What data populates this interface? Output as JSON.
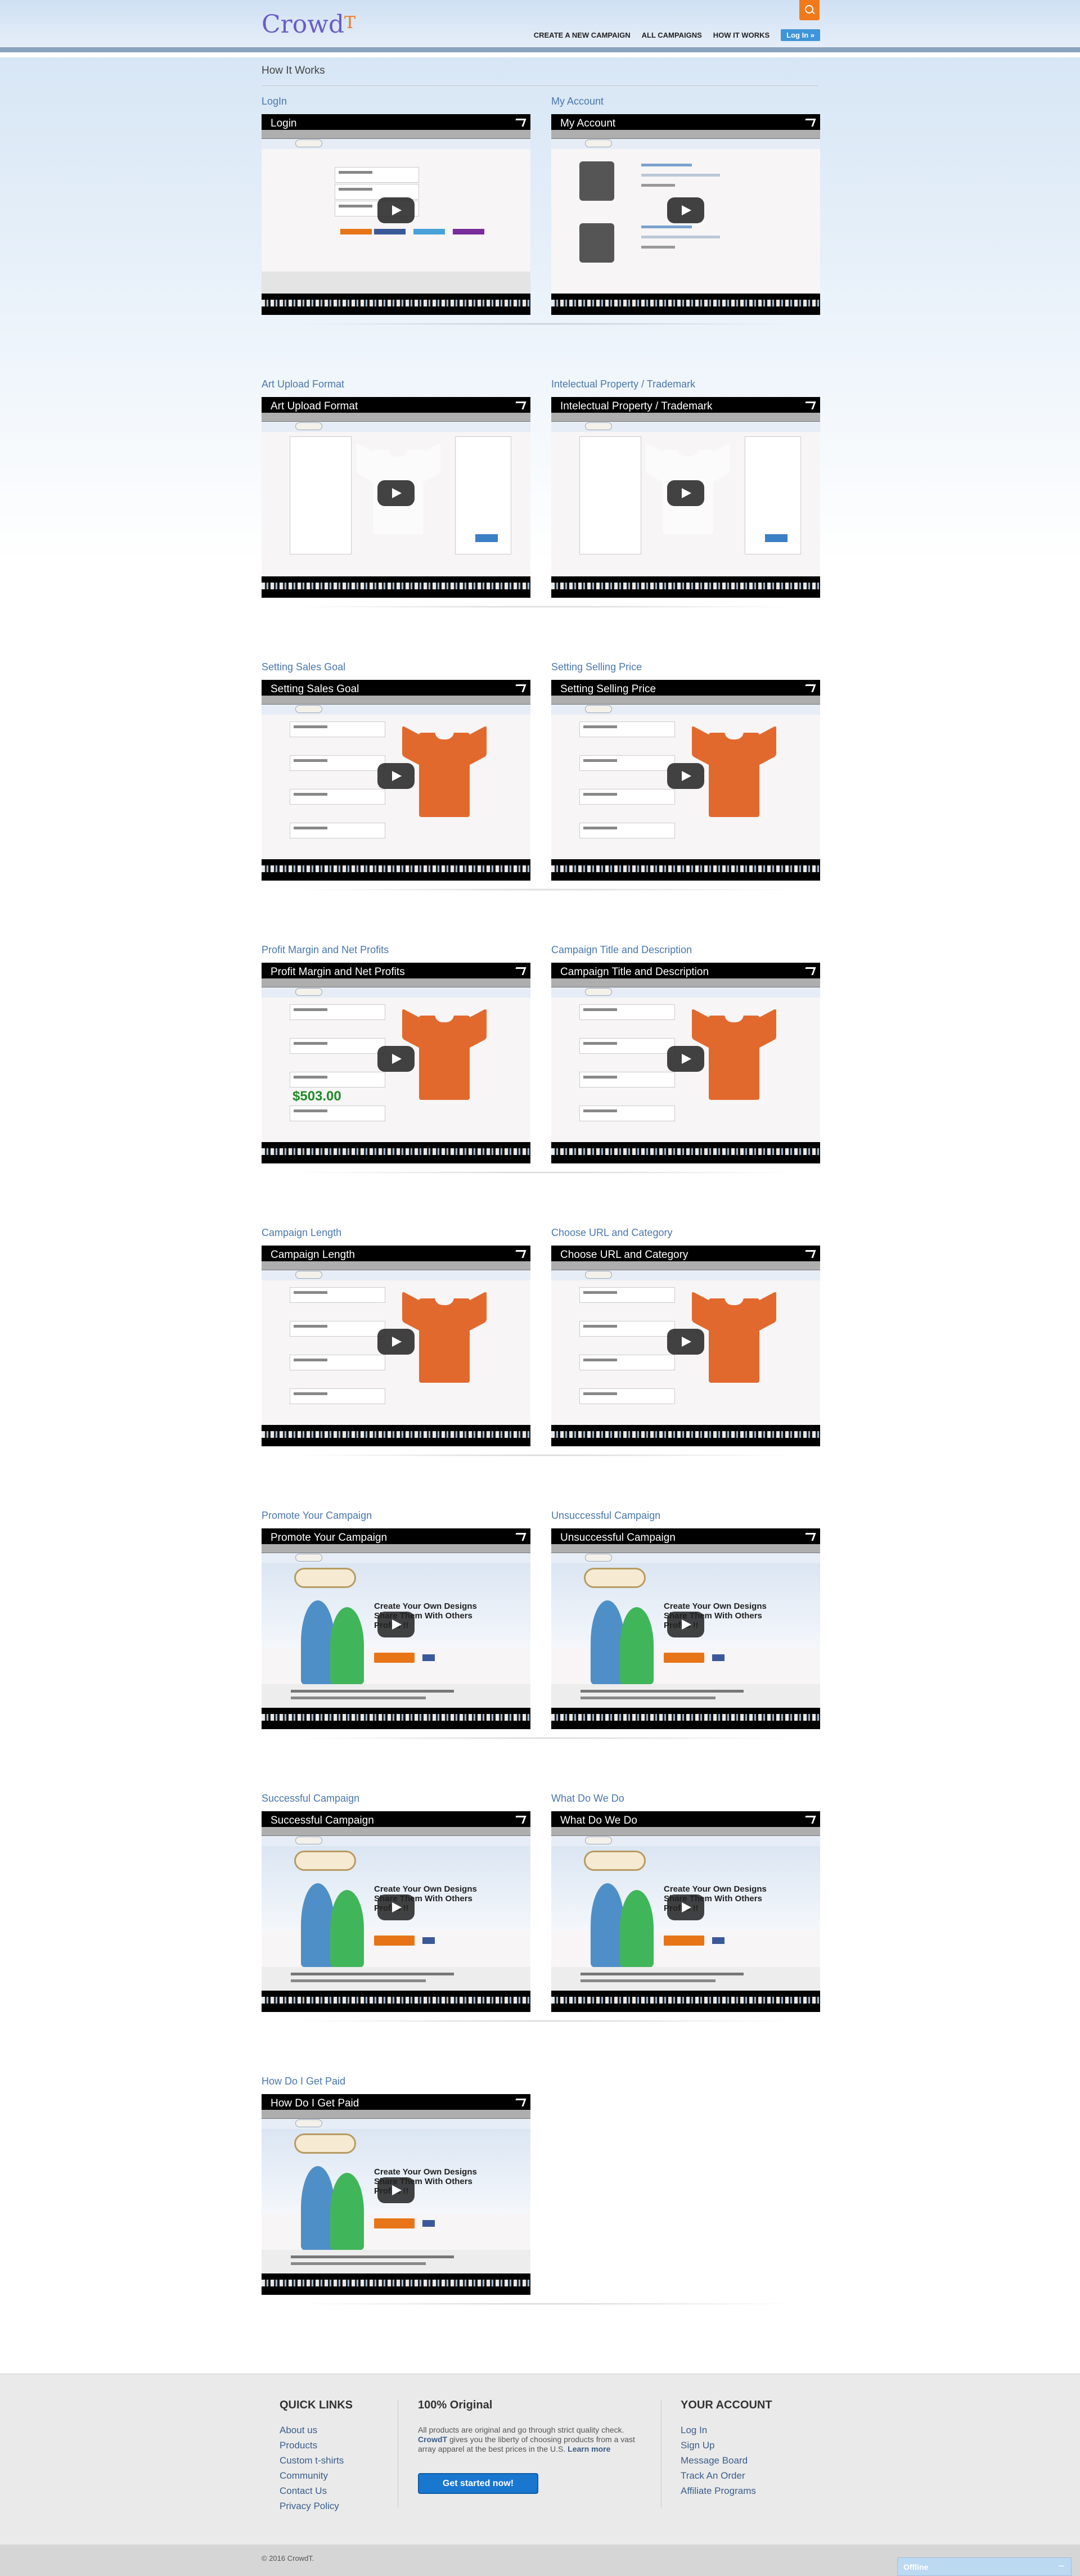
{
  "header": {
    "logo": "Crowd",
    "logo_suffix": "T",
    "nav": [
      "CREATE A NEW CAMPAIGN",
      "ALL CAMPAIGNS",
      "HOW IT WORKS"
    ],
    "login_label": "Log In »"
  },
  "page": {
    "title": "How It Works"
  },
  "videos": [
    {
      "title": "LogIn",
      "player_title": "Login",
      "screen": "login"
    },
    {
      "title": "My Account",
      "player_title": "My Account",
      "screen": "account"
    },
    {
      "title": "Art Upload Format",
      "player_title": "Art Upload Format",
      "screen": "white-shirt"
    },
    {
      "title": "Intelectual Property / Trademark",
      "player_title": "Intelectual Property / Trademark",
      "screen": "white-shirt"
    },
    {
      "title": "Setting Sales Goal",
      "player_title": "Setting Sales Goal",
      "screen": "orange-shirt"
    },
    {
      "title": "Setting Selling Price",
      "player_title": "Setting Selling Price",
      "screen": "orange-shirt"
    },
    {
      "title": "Profit Margin and Net Profits",
      "player_title": "Profit Margin and Net Profits",
      "screen": "orange-shirt-profit",
      "profit_value": "$503.00"
    },
    {
      "title": "Campaign Title and Description",
      "player_title": "Campaign Title and Description",
      "screen": "orange-shirt"
    },
    {
      "title": "Campaign Length",
      "player_title": "Campaign Length",
      "screen": "orange-shirt"
    },
    {
      "title": "Choose URL and Category",
      "player_title": "Choose URL and Category",
      "screen": "orange-shirt"
    },
    {
      "title": "Promote Your Campaign",
      "player_title": "Promote Your Campaign",
      "screen": "hero"
    },
    {
      "title": "Unsuccessful Campaign",
      "player_title": "Unsuccessful Campaign",
      "screen": "hero"
    },
    {
      "title": "Successful Campaign",
      "player_title": "Successful Campaign",
      "screen": "hero"
    },
    {
      "title": "What Do We Do",
      "player_title": "What Do We Do",
      "screen": "hero"
    },
    {
      "title": "How Do I Get Paid",
      "player_title": "How Do I Get Paid",
      "screen": "hero"
    }
  ],
  "hero": {
    "headline": "Create Your Own Designs Share Them With Others Profits !!"
  },
  "footer": {
    "quick_links": {
      "heading": "QUICK LINKS",
      "items": [
        "About us",
        "Products",
        "Custom t-shirts",
        "Community",
        "Contact Us",
        "Privacy Policy"
      ]
    },
    "about": {
      "heading": "100% Original",
      "text_1": "All products are original and go through strict quality check. ",
      "brand": "CrowdT",
      "text_2": " gives you the liberty of choosing products from a vast array apparel at the best prices in the U.S. ",
      "learn_more": "Learn more",
      "button": "Get started now!"
    },
    "account": {
      "heading": "YOUR ACCOUNT",
      "items": [
        "Log In",
        "Sign Up",
        "Message Board",
        "Track An Order",
        "Affiliate Programs"
      ]
    },
    "copyright": "© 2016 CrowdT."
  },
  "chat": {
    "label": "Offline",
    "minimize": "–"
  },
  "colors": {
    "accent": "#f07a1a",
    "link": "#4a77ab",
    "button": "#1a77d0"
  },
  "icons": [
    "search-icon",
    "play-icon",
    "share-icon"
  ]
}
